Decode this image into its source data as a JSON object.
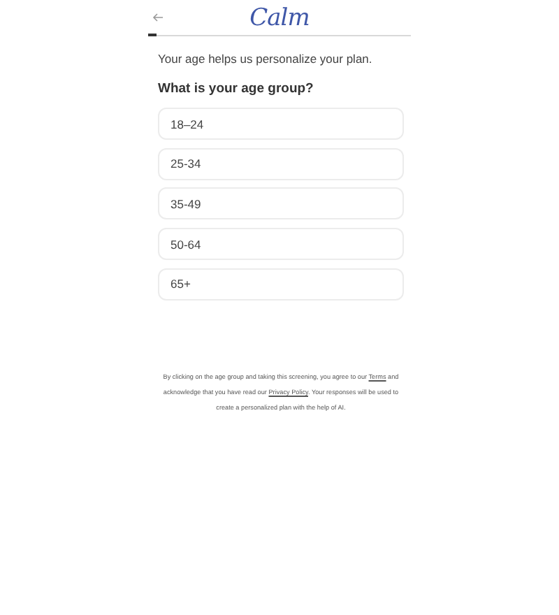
{
  "header": {
    "logo": "Calm"
  },
  "progress": {
    "level": 0.03
  },
  "intro": "Your age helps us personalize your plan.",
  "question": "What is your age group?",
  "options": [
    {
      "label": "18–24",
      "selected": false
    },
    {
      "label": "25-34",
      "selected": false
    },
    {
      "label": "35-49",
      "selected": false
    },
    {
      "label": "50-64",
      "selected": false
    },
    {
      "label": "65+",
      "selected": false
    }
  ],
  "disclaimer": {
    "before": "By clicking on the age group and taking this screening, you agree to our ",
    "terms": "Terms",
    "middle": " and acknowledge that you have read our ",
    "privacy": "Privacy Policy",
    "after": ". Your responses will be used to create a personalized plan with the help of AI."
  }
}
